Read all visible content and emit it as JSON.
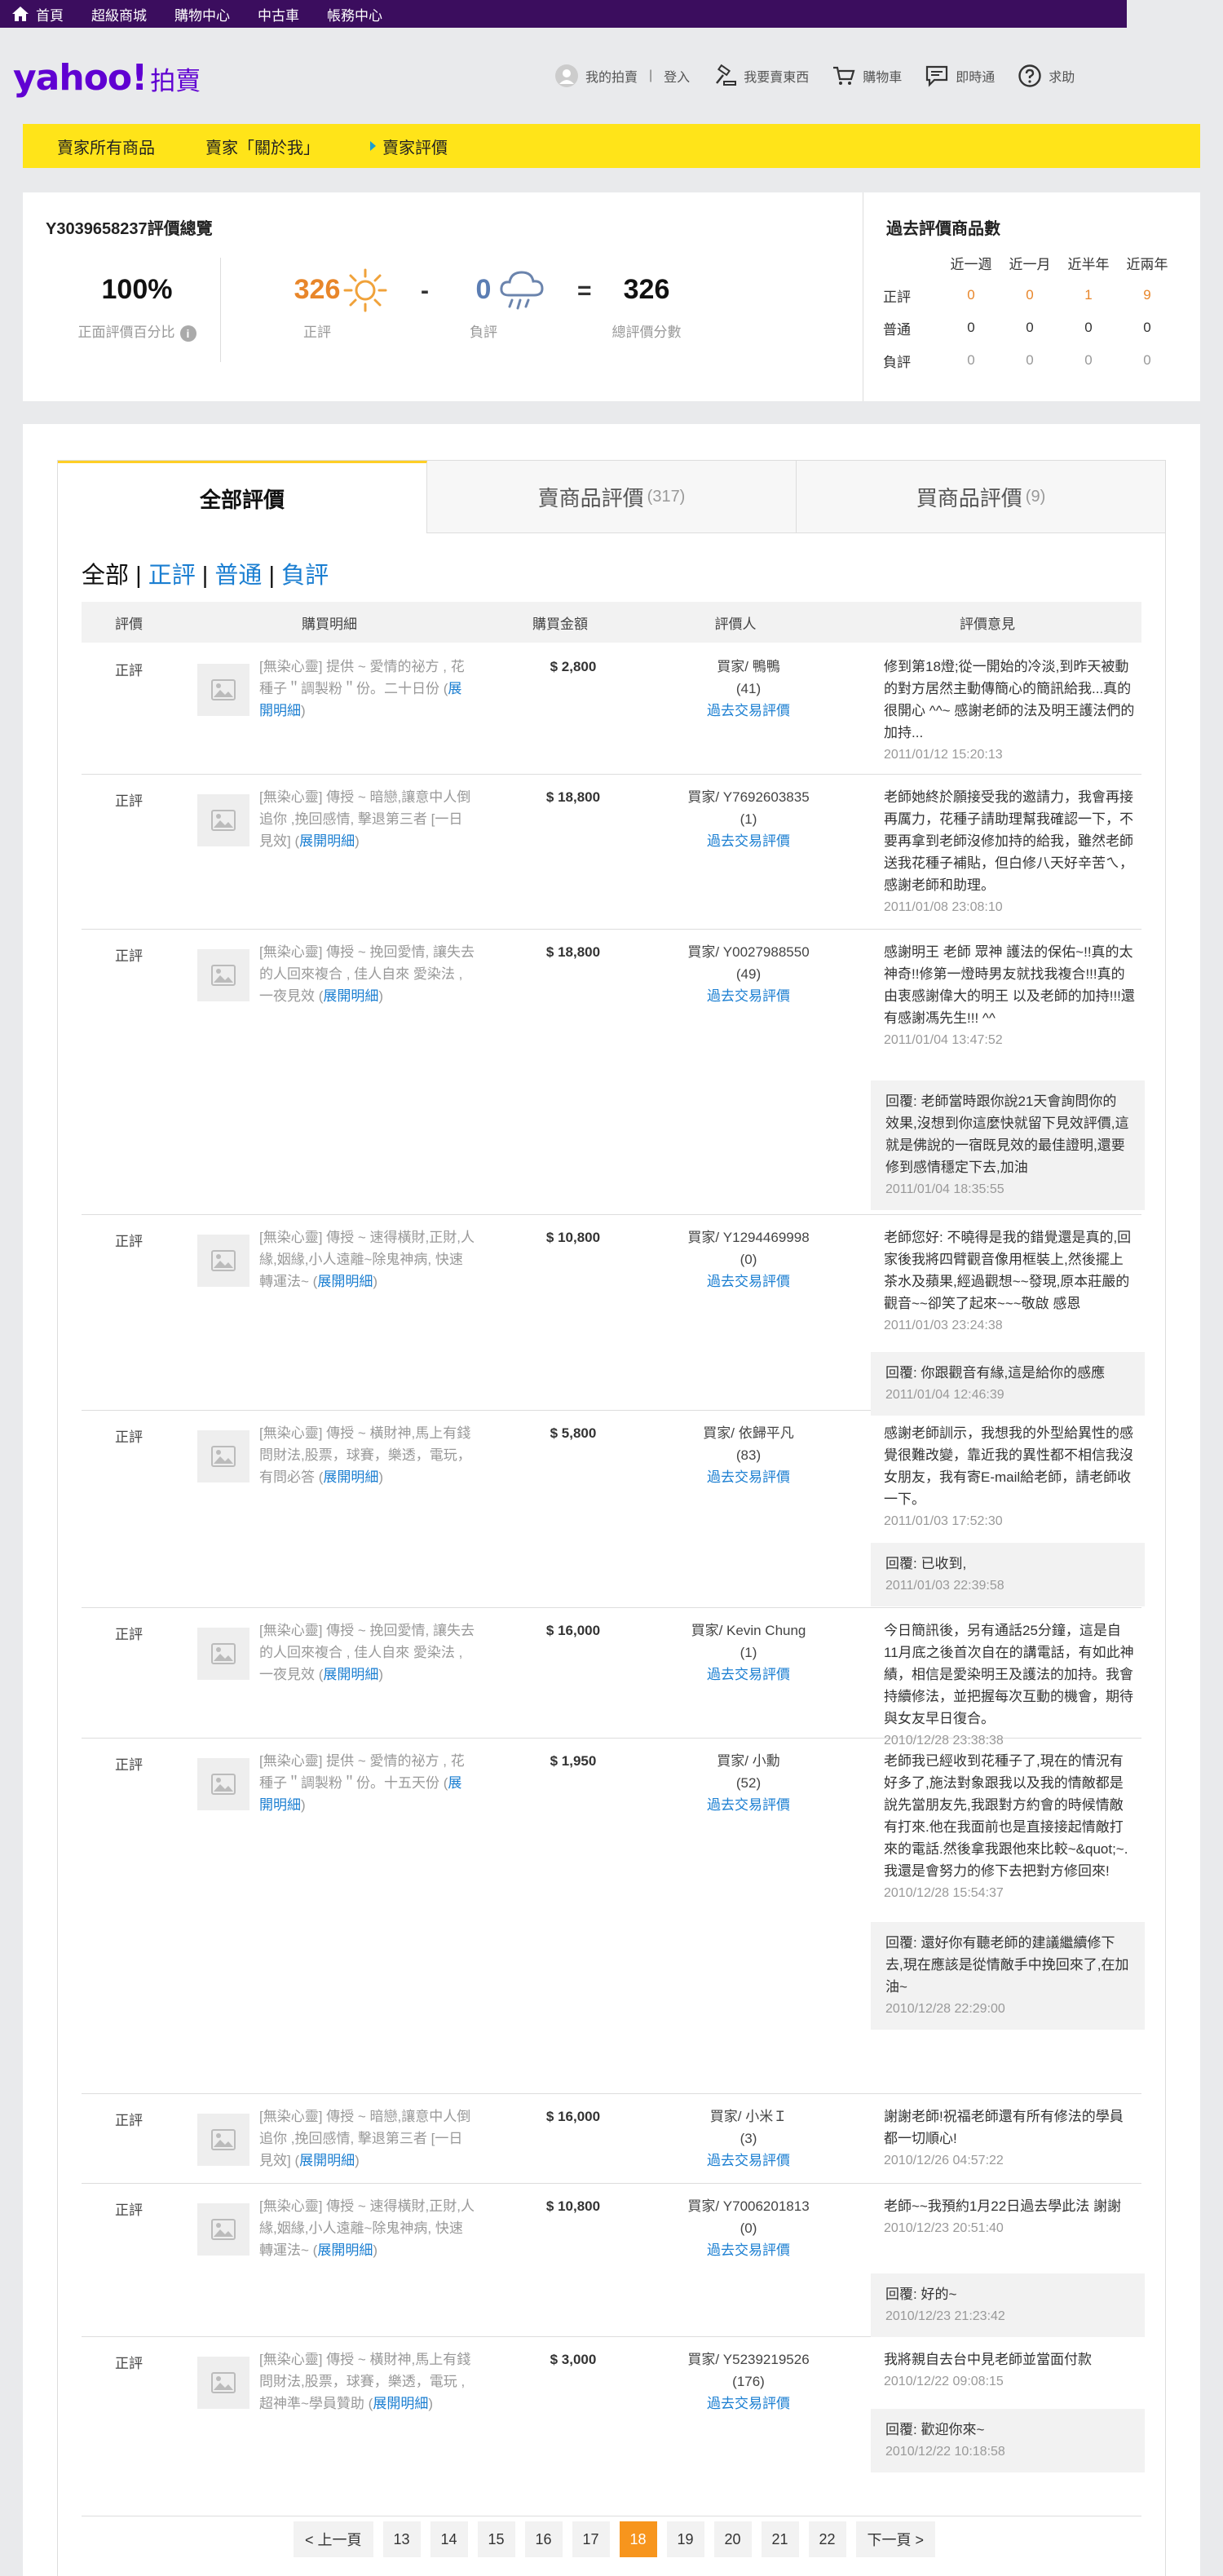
{
  "topnav": [
    "首頁",
    "超級商城",
    "購物中心",
    "中古車",
    "帳務中心"
  ],
  "logo": {
    "brand": "yahoo!",
    "product": "拍賣"
  },
  "header": {
    "my_auction": "我的拍賣",
    "login": "登入",
    "sell": "我要賣東西",
    "cart": "購物車",
    "chat": "即時通",
    "help": "求助"
  },
  "breadcrumbs": [
    "賣家所有商品",
    "賣家「關於我」",
    "賣家評價"
  ],
  "summary": {
    "title": "Y3039658237評價總覽",
    "percent": "100%",
    "percent_label": "正面評價百分比",
    "positive": "326",
    "positive_label": "正評",
    "minus": "-",
    "negative": "0",
    "negative_label": "負評",
    "equals": "=",
    "total": "326",
    "total_label": "總評價分數"
  },
  "past": {
    "title": "過去評價商品數",
    "headers": [
      "近一週",
      "近一月",
      "近半年",
      "近兩年"
    ],
    "rows": [
      {
        "label": "正評",
        "values": [
          "0",
          "0",
          "1",
          "9"
        ]
      },
      {
        "label": "普通",
        "values": [
          "0",
          "0",
          "0",
          "0"
        ]
      },
      {
        "label": "負評",
        "values": [
          "0",
          "0",
          "0",
          "0"
        ]
      }
    ]
  },
  "tabs": [
    {
      "label": "全部評價",
      "count": ""
    },
    {
      "label": "賣商品評價",
      "count": "(317)"
    },
    {
      "label": "買商品評價",
      "count": "(9)"
    }
  ],
  "filters": {
    "all": "全部",
    "sep": "|",
    "pos": "正評",
    "neutral": "普通",
    "neg": "負評"
  },
  "columns": [
    "評價",
    "購買明細",
    "購買金額",
    "評價人",
    "評價意見"
  ],
  "expand_label": "展開明細",
  "history_label": "過去交易評價",
  "rows": [
    {
      "rating": "正評",
      "desc": "[無染心靈] 提供 ~ 愛情的祕方 , 花種子＂調製粉＂份。二十日份",
      "amount": "$ 2,800",
      "rater": "買家/ 鴨鴨",
      "rater_count": "(41)",
      "comment": "修到第18燈;從一開始的冷淡,到昨天被動的對方居然主動傳簡心的簡訊給我...真的很開心 ^^~ 感謝老師的法及明王護法們的加持...",
      "date": "2011/01/12 15:20:13"
    },
    {
      "rating": "正評",
      "desc": "[無染心靈] 傳授 ~ 暗戀,讓意中人倒追你 ,挽回感情, 擊退第三者 [一日見效]",
      "amount": "$ 18,800",
      "rater": "買家/ Y7692603835",
      "rater_count": "(1)",
      "comment": "老師她終於願接受我的邀請力，我會再接再厲力，花種子請助理幫我確認一下，不要再拿到老師沒修加持的給我，雖然老師送我花種子補貼，但白修八天好辛苦ㄟ，感謝老師和助理。",
      "date": "2011/01/08 23:08:10"
    },
    {
      "rating": "正評",
      "desc": "[無染心靈] 傳授 ~ 挽回愛情, 讓失去的人回來複合 , 佳人自來 愛染法 , 一夜見效",
      "amount": "$ 18,800",
      "rater": "買家/ Y0027988550",
      "rater_count": "(49)",
      "comment": "感謝明王 老師 眾神 護法的保佑~!!真的太神奇!!修第一燈時男友就找我複合!!!真的由衷感謝偉大的明王 以及老師的加持!!!還有感謝馮先生!!! ^^",
      "date": "2011/01/04 13:47:52",
      "reply": "回覆: 老師當時跟你說21天會詢問你的效果,沒想到你這麼快就留下見效評價,這就是佛說的一宿既見效的最佳證明,還要修到感情穩定下去,加油",
      "reply_date": "2011/01/04 18:35:55"
    },
    {
      "rating": "正評",
      "desc": "[無染心靈] 傳授 ~ 速得橫財,正財,人緣,姻緣,小人遠離~除鬼神病, 快速轉運法~",
      "amount": "$ 10,800",
      "rater": "買家/ Y1294469998",
      "rater_count": "(0)",
      "comment": "老師您好: 不曉得是我的錯覺還是真的,回家後我將四臂觀音像用框裝上,然後擺上茶水及蘋果,經過觀想~~發現,原本莊嚴的觀音~~卻笑了起來~~~敬啟 感恩",
      "date": "2011/01/03 23:24:38",
      "reply": "回覆: 你跟觀音有緣,這是給你的感應",
      "reply_date": "2011/01/04 12:46:39"
    },
    {
      "rating": "正評",
      "desc": "[無染心靈] 傳授 ~ 橫財神,馬上有錢問財法,股票，球賽，樂透，電玩，有問必答",
      "amount": "$ 5,800",
      "rater": "買家/ 依歸平凡",
      "rater_count": "(83)",
      "comment": "感謝老師訓示，我想我的外型給異性的感覺很難改變，靠近我的異性都不相信我沒女朋友，我有寄E-mail給老師，請老師收一下。",
      "date": "2011/01/03 17:52:30",
      "reply": "回覆: 已收到,",
      "reply_date": "2011/01/03 22:39:58"
    },
    {
      "rating": "正評",
      "desc": "[無染心靈] 傳授 ~ 挽回愛情, 讓失去的人回來複合 , 佳人自來 愛染法 , 一夜見效",
      "amount": "$ 16,000",
      "rater": "買家/ Kevin Chung",
      "rater_count": "(1)",
      "comment": "今日簡訊後，另有通話25分鐘，這是自11月底之後首次自在的講電話，有如此神績，相信是愛染明王及護法的加持。我會持續修法，並把握每次互動的機會，期待與女友早日復合。",
      "date": "2010/12/28 23:38:38"
    },
    {
      "rating": "正評",
      "desc": "[無染心靈] 提供 ~ 愛情的祕方 , 花種子＂調製粉＂份。十五天份",
      "amount": "$ 1,950",
      "rater": "買家/ 小勳",
      "rater_count": "(52)",
      "comment": "老師我已經收到花種子了,現在的情況有好多了,施法對象跟我以及我的情敵都是說先當朋友先,我跟對方約會的時候情敵有打來.他在我面前也是直接接起情敵打來的電話.然後拿我跟他來比較~&quot;~.我還是會努力的修下去把對方修回來!",
      "date": "2010/12/28 15:54:37",
      "reply": "回覆: 還好你有聽老師的建議繼續修下去,現在應該是從情敵手中挽回來了,在加油~",
      "reply_date": "2010/12/28 22:29:00"
    },
    {
      "rating": "正評",
      "desc": "[無染心靈] 傳授 ~ 暗戀,讓意中人倒追你 ,挽回感情, 擊退第三者 [一日見效]",
      "amount": "$ 16,000",
      "rater": "買家/ 小米Ｉ",
      "rater_count": "(3)",
      "comment": "謝謝老師!祝福老師還有所有修法的學員都一切順心!",
      "date": "2010/12/26 04:57:22"
    },
    {
      "rating": "正評",
      "desc": "[無染心靈] 傳授 ~ 速得橫財,正財,人緣,姻緣,小人遠離~除鬼神病, 快速轉運法~",
      "amount": "$ 10,800",
      "rater": "買家/ Y7006201813",
      "rater_count": "(0)",
      "comment": "老師~~我預約1月22日過去學此法 謝謝",
      "date": "2010/12/23 20:51:40",
      "reply": "回覆: 好的~",
      "reply_date": "2010/12/23 21:23:42"
    },
    {
      "rating": "正評",
      "desc": "[無染心靈] 傳授 ~ 橫財神,馬上有錢問財法,股票，球賽，樂透，電玩 ,超神準~學員贊助",
      "amount": "$ 3,000",
      "rater": "買家/ Y5239219526",
      "rater_count": "(176)",
      "comment": "我將親自去台中見老師並當面付款",
      "date": "2010/12/22 09:08:15",
      "reply": "回覆: 歡迎你來~",
      "reply_date": "2010/12/22 10:18:58"
    }
  ],
  "pager": {
    "prev": "< 上一頁",
    "pages": [
      "13",
      "14",
      "15",
      "16",
      "17",
      "18",
      "19",
      "20",
      "21",
      "22"
    ],
    "current": "18",
    "next": "下一頁 >"
  }
}
